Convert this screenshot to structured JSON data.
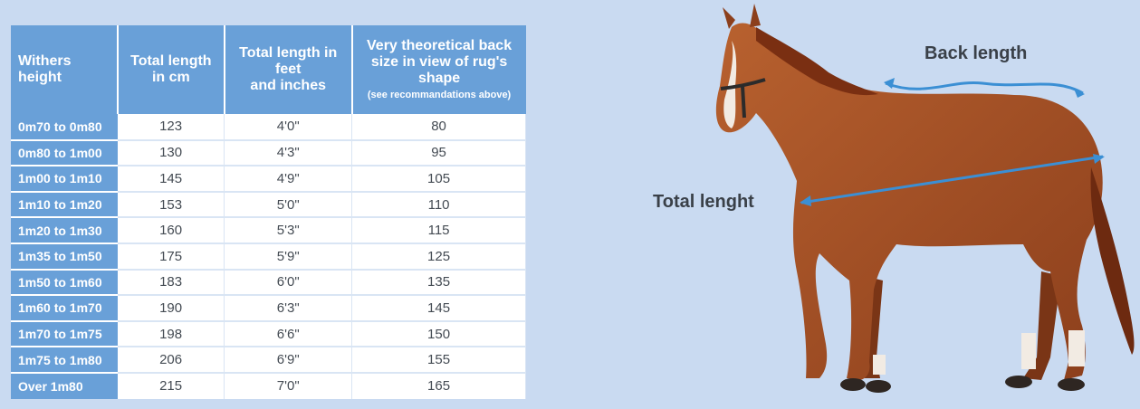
{
  "table": {
    "headers": [
      {
        "line1": "Withers",
        "line2": "height",
        "line3": "",
        "note": ""
      },
      {
        "line1": "Total length",
        "line2": "in cm",
        "line3": "",
        "note": ""
      },
      {
        "line1": "Total length in",
        "line2": "feet",
        "line3": "and inches",
        "note": ""
      },
      {
        "line1": "Very theoretical back",
        "line2": "size in view of rug's",
        "line3": "shape",
        "note": "(see recommandations above)"
      }
    ],
    "rows": [
      {
        "height": "0m70 to 0m80",
        "cm": "123",
        "feet": "4'0\"",
        "back": "80"
      },
      {
        "height": "0m80 to 1m00",
        "cm": "130",
        "feet": "4'3\"",
        "back": "95"
      },
      {
        "height": "1m00 to 1m10",
        "cm": "145",
        "feet": "4'9\"",
        "back": "105"
      },
      {
        "height": "1m10 to 1m20",
        "cm": "153",
        "feet": "5'0\"",
        "back": "110"
      },
      {
        "height": "1m20 to 1m30",
        "cm": "160",
        "feet": "5'3\"",
        "back": "115"
      },
      {
        "height": "1m35 to 1m50",
        "cm": "175",
        "feet": "5'9\"",
        "back": "125"
      },
      {
        "height": "1m50 to 1m60",
        "cm": "183",
        "feet": "6'0\"",
        "back": "135"
      },
      {
        "height": "1m60 to 1m70",
        "cm": "190",
        "feet": "6'3\"",
        "back": "145"
      },
      {
        "height": "1m70 to 1m75",
        "cm": "198",
        "feet": "6'6\"",
        "back": "150"
      },
      {
        "height": "1m75 to 1m80",
        "cm": "206",
        "feet": "6'9\"",
        "back": "155"
      },
      {
        "height": "Over 1m80",
        "cm": "215",
        "feet": "7'0\"",
        "back": "165"
      }
    ]
  },
  "illustration": {
    "back_label": "Back length",
    "total_label": "Total lenght"
  },
  "colors": {
    "background": "#c9daf1",
    "header": "#69a0d8",
    "arrow": "#3b8fd4",
    "horse": "#a8552a"
  }
}
